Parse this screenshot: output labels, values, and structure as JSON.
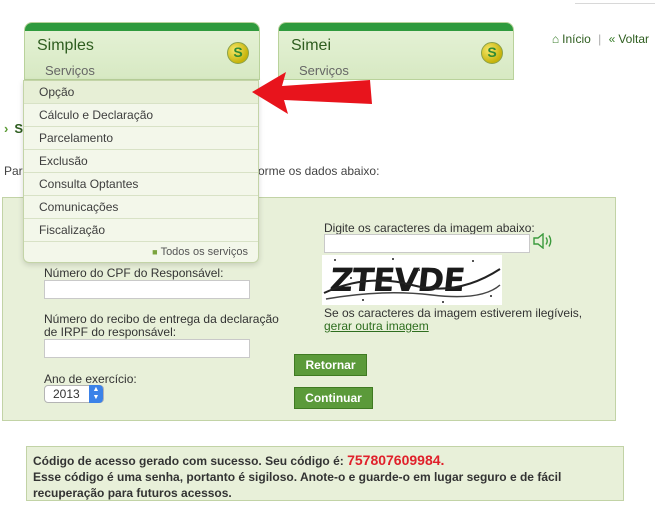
{
  "tabs": [
    {
      "title": "Simples",
      "subtitle": "Serviços"
    },
    {
      "title": "Simei",
      "subtitle": "Serviços"
    }
  ],
  "top_links": {
    "home": "Início",
    "back": "Voltar"
  },
  "menu": {
    "items": [
      "Opção",
      "Cálculo e Declaração",
      "Parcelamento",
      "Exclusão",
      "Consulta Optantes",
      "Comunicações",
      "Fiscalização"
    ],
    "all_services": "Todos os serviços"
  },
  "section": {
    "title_visible": "S",
    "instruction_start": "Para",
    "instruction_end": "orme os dados abaixo:"
  },
  "form": {
    "cpf_label": "Número do CPF do Responsável:",
    "cpf_value": "",
    "receipt_label_line1": "Número do recibo de entrega da declaração",
    "receipt_label_line2": "de IRPF do responsável:",
    "receipt_value": "",
    "year_label": "Ano de exercício:",
    "year_value": "2013",
    "captcha_label": "Digite os caracteres da imagem abaixo:",
    "captcha_value": "",
    "captcha_text": "ZTEVDE",
    "captcha_hint": "Se os caracteres da imagem estiverem ilegíveis,",
    "captcha_regen": "gerar outra imagem",
    "btn_back": "Retornar",
    "btn_continue": "Continuar"
  },
  "success": {
    "line1_prefix": "Código de acesso gerado com sucesso. Seu código é: ",
    "code": "757807609984",
    "line1_suffix": ".",
    "line2": "Esse código é uma senha, portanto é sigiloso. Anote-o e guarde-o em lugar seguro e de fácil",
    "line3": "recuperação para futuros acessos."
  },
  "colors": {
    "accent_green": "#5b9a3a",
    "panel_bg": "#e8f0d9",
    "code_red": "#e0202a",
    "annotation_arrow": "#e8141c"
  },
  "icons": {
    "home": "home-icon",
    "back": "back-icon",
    "speaker": "speaker-icon",
    "logo": "simples-logo-icon"
  }
}
